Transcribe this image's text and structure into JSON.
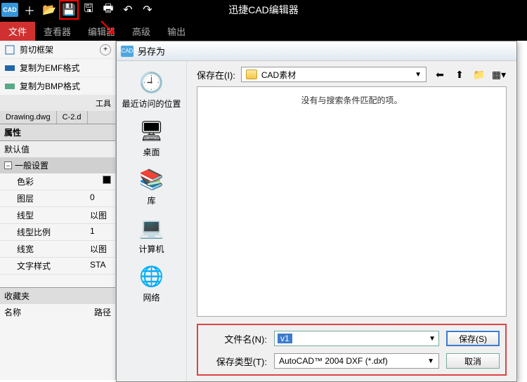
{
  "app": {
    "title": "迅捷CAD编辑器"
  },
  "menu": {
    "file": "文件",
    "viewer": "查看器",
    "editor": "编辑器",
    "advanced": "高级",
    "output": "输出"
  },
  "tools": {
    "crop": "剪切框架",
    "emf": "复制为EMF格式",
    "bmp": "复制为BMP格式",
    "header": "工具",
    "round": "+"
  },
  "doctabs": {
    "first": "Drawing.dwg",
    "second": "C-2.d"
  },
  "props": {
    "header": "属性",
    "defaults": "默认值",
    "general": "一般设置",
    "color": "色彩",
    "colorVal": "",
    "layer": "图层",
    "layerVal": "0",
    "linetype": "线型",
    "linetypeVal": "以图",
    "scale": "线型比例",
    "scaleVal": "1",
    "width": "线宽",
    "widthVal": "以图",
    "style": "文字样式",
    "styleVal": "STA"
  },
  "fav": {
    "header": "收藏夹",
    "name": "名称",
    "path": "路径"
  },
  "dialog": {
    "title": "另存为",
    "locLabel": "保存在(I):",
    "locValue": "CAD素材",
    "emptyMsg": "没有与搜索条件匹配的项。",
    "side": {
      "recent": "最近访问的位置",
      "desktop": "桌面",
      "library": "库",
      "computer": "计算机",
      "network": "网络"
    },
    "fnLabel": "文件名(N):",
    "fnValue": "v1",
    "ftLabel": "保存类型(T):",
    "ftValue": "AutoCAD™ 2004 DXF (*.dxf)",
    "save": "保存(S)",
    "cancel": "取消"
  }
}
